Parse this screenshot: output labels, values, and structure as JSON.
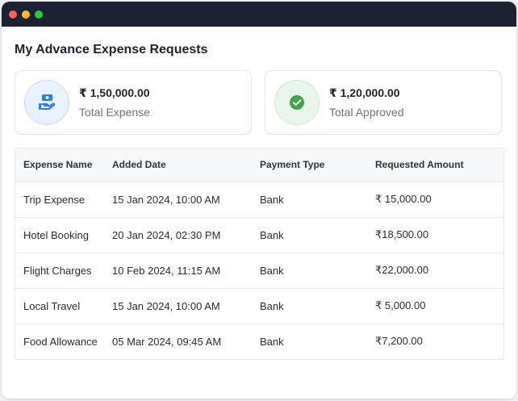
{
  "window": {
    "controls": [
      "close",
      "minimize",
      "maximize"
    ],
    "colors": {
      "close": "#ff5f57",
      "minimize": "#febc2e",
      "maximize": "#28c840"
    }
  },
  "page": {
    "title": "My Advance Expense Requests"
  },
  "cards": [
    {
      "amount": "₹ 1,50,000.00",
      "label": "Total Expense",
      "icon": "money-hand-icon",
      "accent": "#2f7be6"
    },
    {
      "amount": "₹ 1,20,000.00",
      "label": "Total Approved",
      "icon": "check-circle-icon",
      "accent": "#3aa54a"
    }
  ],
  "table": {
    "headers": [
      "Expense Name",
      "Added Date",
      "Payment Type",
      "Requested Amount"
    ],
    "rows": [
      [
        "Trip Expense",
        "15 Jan 2024, 10:00 AM",
        "Bank",
        "₹ 15,000.00"
      ],
      [
        "Hotel Booking",
        "20 Jan 2024, 02:30 PM",
        "Bank",
        "₹18,500.00"
      ],
      [
        "Flight Charges",
        "10 Feb 2024, 11:15 AM",
        "Bank",
        "₹22,000.00"
      ],
      [
        "Local Travel",
        "15 Jan 2024, 10:00 AM",
        "Bank",
        "₹ 5,000.00"
      ],
      [
        "Food Allowance",
        "05 Mar 2024, 09:45 AM",
        "Bank",
        "₹7,200.00"
      ]
    ]
  }
}
